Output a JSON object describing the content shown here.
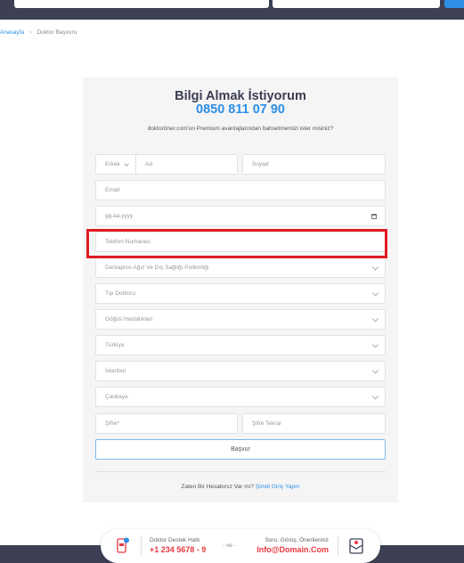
{
  "breadcrumb": {
    "home": "Anasayfa",
    "separator": "›",
    "current": "Doktor Başvuru"
  },
  "form": {
    "title": "Bilgi Almak İstiyorum",
    "phone": "0850 811 07 90",
    "description": "doktoröner.com'un Premium avantajlarından bahsetmemizi ister misiniz?",
    "gender": "Erkek",
    "first_name_placeholder": "Ad",
    "last_name_placeholder": "Soyad",
    "email_placeholder": "Email",
    "birthdate_placeholder": "gg.aa.yyyy",
    "phone_placeholder": "Telefon Numarası",
    "clinic": "Dentapros Ağız Ve Dış Sağlığı Polikinliği",
    "doctor_type": "Tıp Doktoru",
    "specialty": "Göğüs Hastalıkları",
    "country": "Türkiye",
    "city": "İstanbul",
    "district": "Çankaya",
    "password_placeholder": "Şifre*",
    "password_repeat_placeholder": "Şifre Tekrar",
    "submit_label": "Başvur",
    "login_prompt": "Zaten Bir Hesabınız Var mı?",
    "login_link": "Şimdi Giriş Yapın"
  },
  "footer": {
    "support_label": "Doktor Destek Hattı",
    "support_number": "+1 234 5678 - 9",
    "and_text": "- ve -",
    "feedback_label": "Soru, Görüş, Önerileriniz",
    "email": "Info@Domain.Com"
  },
  "colors": {
    "accent": "#2d8fe6",
    "dark": "#3d4055",
    "highlight": "#e01a22",
    "footer_text": "#e8373e"
  }
}
